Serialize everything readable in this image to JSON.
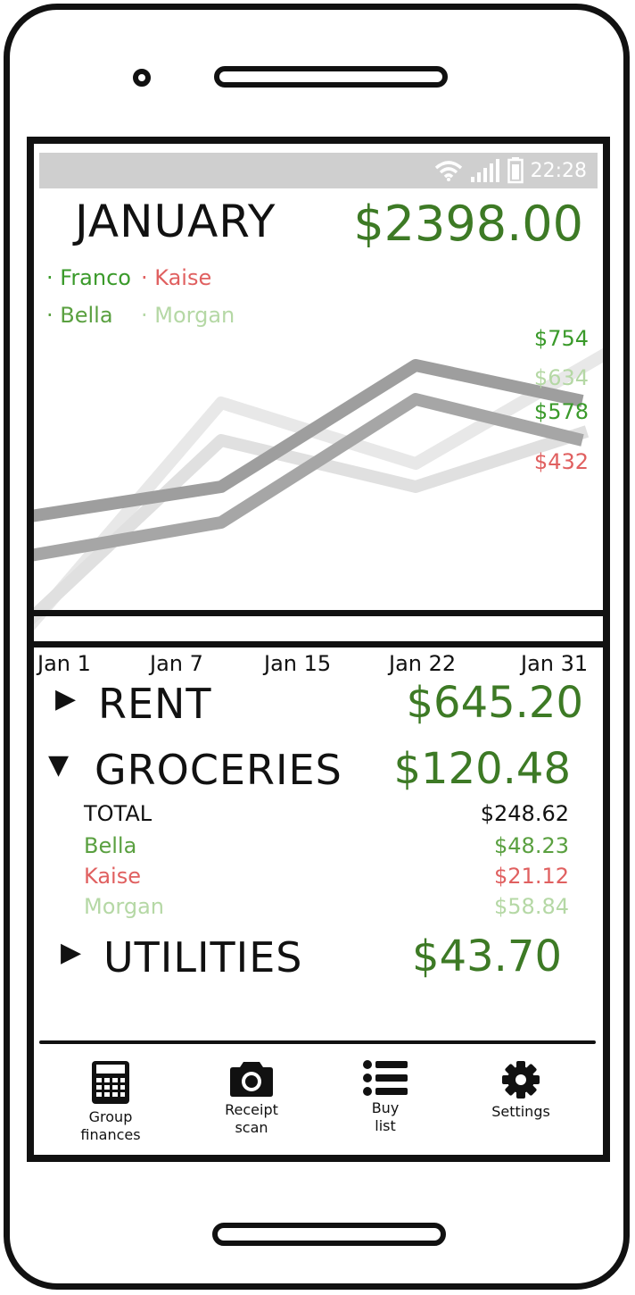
{
  "status_bar": {
    "time": "22:28"
  },
  "header": {
    "month": "JANUARY",
    "total": "$2398.00"
  },
  "legend": [
    {
      "name": "Franco",
      "color": "#3a9a2a"
    },
    {
      "name": "Kaise",
      "color": "#e06060"
    },
    {
      "name": "Bella",
      "color": "#5aa040"
    },
    {
      "name": "Morgan",
      "color": "#b5d8a5"
    }
  ],
  "chart_data": {
    "type": "line",
    "x": [
      "Jan 1",
      "Jan 7",
      "Jan 15",
      "Jan 22",
      "Jan 31"
    ],
    "end_labels": [
      {
        "text": "$754",
        "color": "#3a9a2a"
      },
      {
        "text": "$634",
        "color": "#b5d8a5"
      },
      {
        "text": "$578",
        "color": "#3a9a2a"
      },
      {
        "text": "$432",
        "color": "#e06060"
      }
    ]
  },
  "categories": [
    {
      "name": "RENT",
      "amount": "$645.20",
      "expanded": false
    },
    {
      "name": "GROCERIES",
      "amount": "$120.48",
      "expanded": true,
      "breakdown": [
        {
          "label": "TOTAL",
          "value": "$248.62",
          "color": "#111111"
        },
        {
          "label": "Bella",
          "value": "$48.23",
          "color": "#5aa040"
        },
        {
          "label": "Kaise",
          "value": "$21.12",
          "color": "#e06060"
        },
        {
          "label": "Morgan",
          "value": "$58.84",
          "color": "#b5d8a5"
        }
      ]
    },
    {
      "name": "UTILITIES",
      "amount": "$43.70",
      "expanded": false
    }
  ],
  "nav": [
    {
      "line1": "Group",
      "line2": "finances",
      "icon": "calculator-icon"
    },
    {
      "line1": "Receipt",
      "line2": "scan",
      "icon": "camera-icon"
    },
    {
      "line1": "Buy",
      "line2": "list",
      "icon": "list-icon"
    },
    {
      "line1": "Settings",
      "line2": "",
      "icon": "gear-icon"
    }
  ]
}
